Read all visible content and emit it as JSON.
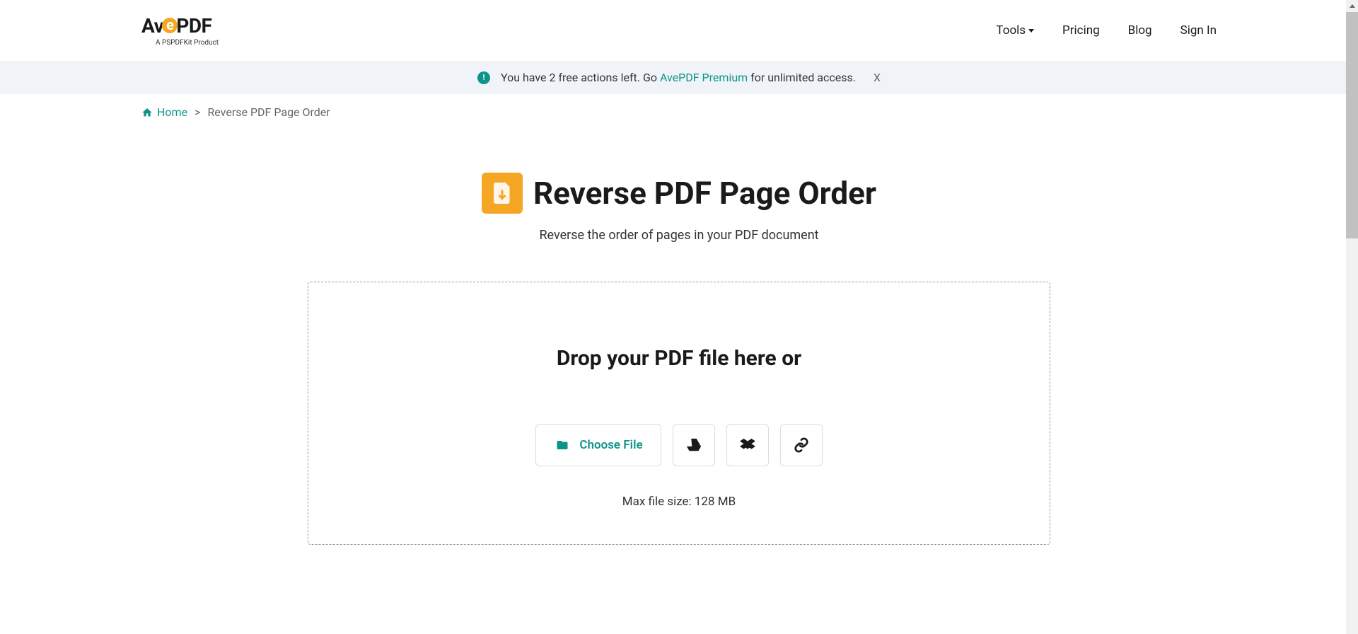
{
  "logo": {
    "prefix": "Av",
    "suffix": "PDF",
    "subtitle": "A PSPDFKit Product"
  },
  "nav": {
    "tools": "Tools",
    "pricing": "Pricing",
    "blog": "Blog",
    "signin": "Sign In"
  },
  "banner": {
    "text_before": "You have 2 free actions left. Go ",
    "link": "AvePDF Premium",
    "text_after": " for unlimited access.",
    "close": "X"
  },
  "breadcrumb": {
    "home": "Home",
    "separator": ">",
    "current": "Reverse PDF Page Order"
  },
  "page": {
    "title": "Reverse PDF Page Order",
    "subtitle": "Reverse the order of pages in your PDF document"
  },
  "dropzone": {
    "text": "Drop your PDF file here or",
    "choose": "Choose File",
    "maxsize": "Max file size: 128 MB"
  }
}
